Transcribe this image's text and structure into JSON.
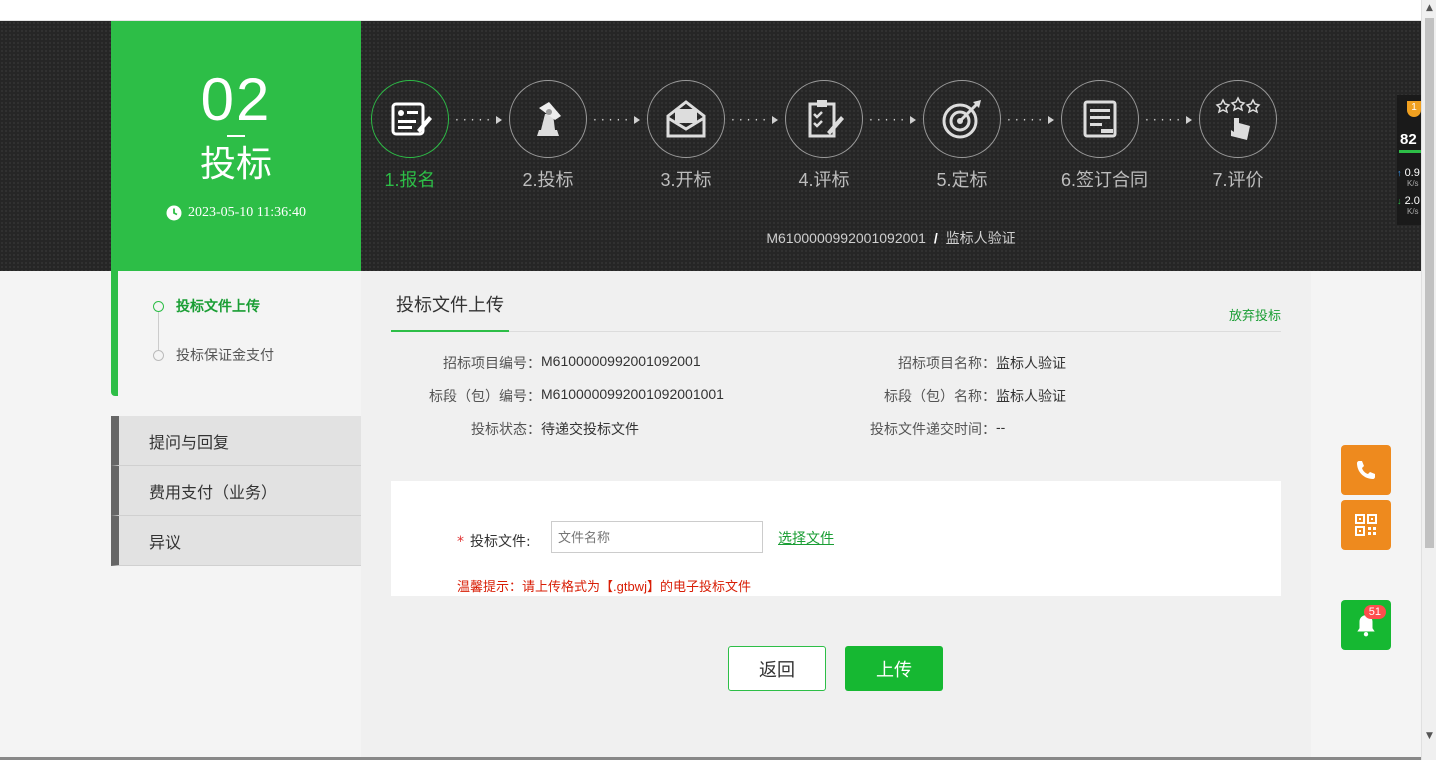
{
  "stage": {
    "number": "02",
    "name": "投标",
    "time": "2023-05-10 11:36:40"
  },
  "steps": [
    {
      "label": "1.报名",
      "icon": "signup-icon",
      "active": true
    },
    {
      "label": "2.投标",
      "icon": "bid-icon",
      "active": false
    },
    {
      "label": "3.开标",
      "icon": "open-envelope-icon",
      "active": false
    },
    {
      "label": "4.评标",
      "icon": "clipboard-icon",
      "active": false
    },
    {
      "label": "5.定标",
      "icon": "target-icon",
      "active": false
    },
    {
      "label": "6.签订合同",
      "icon": "contract-icon",
      "active": false
    },
    {
      "label": "7.评价",
      "icon": "rating-icon",
      "active": false
    }
  ],
  "breadcrumb": {
    "code": "M6100000992001092001",
    "separator": "/",
    "name": "监标人验证"
  },
  "subnav": {
    "items": [
      "投标文件上传",
      "投标保证金支付"
    ]
  },
  "menu": {
    "items": [
      "提问与回复",
      "费用支付（业务）",
      "异议"
    ]
  },
  "main": {
    "tab": "投标文件上传",
    "abandon": "放弃投标",
    "info": {
      "project_code_label": "招标项目编号：",
      "project_code": "M6100000992001092001",
      "project_name_label": "招标项目名称：",
      "project_name": "监标人验证",
      "section_code_label": "标段（包）编号：",
      "section_code": "M6100000992001092001001",
      "section_name_label": "标段（包）名称：",
      "section_name": "监标人验证",
      "status_label": "投标状态：",
      "status": "待递交投标文件",
      "submit_time_label": "投标文件递交时间：",
      "submit_time": "--"
    },
    "upload": {
      "required_mark": "*",
      "label": "投标文件:",
      "placeholder": "文件名称",
      "choose": "选择文件",
      "tip": "温馨提示：请上传格式为【.gtbwj】的电子投标文件"
    },
    "buttons": {
      "back": "返回",
      "upload": "上传"
    }
  },
  "side_tools": {
    "bell_count": "51"
  },
  "monitor": {
    "badge": "1",
    "score": "82",
    "up": "0.9",
    "down": "2.0",
    "unit": "K/s"
  },
  "colors": {
    "brand_green": "#2dbe47",
    "button_green": "#16b832",
    "orange": "#ee8a1e",
    "tip_red": "#d81e06"
  }
}
